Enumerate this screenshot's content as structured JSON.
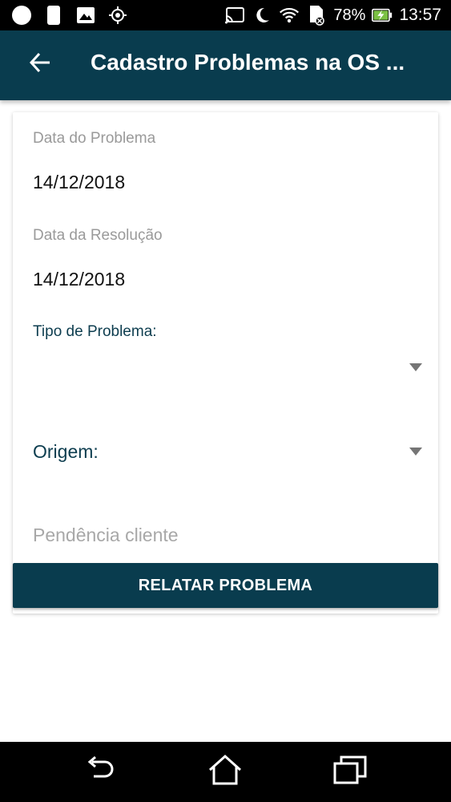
{
  "status_bar": {
    "battery_percent": "78%",
    "clock": "13:57",
    "left_icons": [
      "circle-notification-icon",
      "sd-card-icon",
      "image-icon",
      "location-icon"
    ],
    "right_icons": [
      "cast-icon",
      "moon-icon",
      "wifi-icon",
      "sim-no-service-icon",
      "battery-charging-icon"
    ]
  },
  "app_bar": {
    "title": "Cadastro Problemas na OS ...",
    "background_color": "#093c4e",
    "back_icon": "arrow-left-icon"
  },
  "form": {
    "problem_date": {
      "label": "Data do Problema",
      "value": "14/12/2018"
    },
    "resolution_date": {
      "label": "Data da Resolução",
      "value": "14/12/2018"
    },
    "problem_type": {
      "label": "Tipo de Problema:",
      "value": ""
    },
    "origin": {
      "label": "Origem:",
      "value": ""
    },
    "client_pending": {
      "placeholder": "Pendência cliente",
      "value": ""
    },
    "submit_label": "RELATAR PROBLEMA"
  },
  "nav_bar": {
    "icons": [
      "back-nav-icon",
      "home-nav-icon",
      "recent-apps-icon"
    ]
  }
}
